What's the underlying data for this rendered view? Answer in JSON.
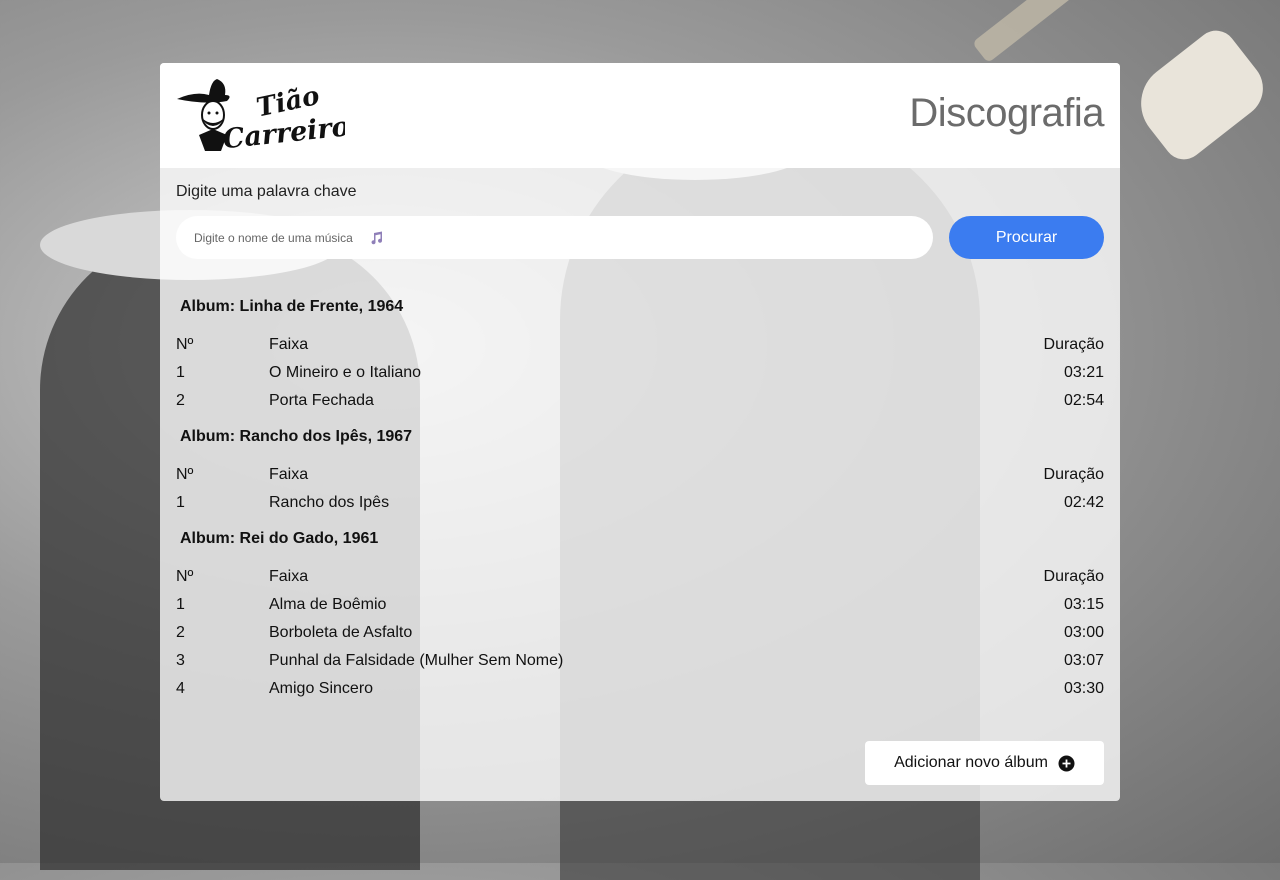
{
  "header": {
    "logo_text_line1": "Tião",
    "logo_text_line2": "Carreiro",
    "title": "Discografia"
  },
  "search": {
    "label": "Digite uma palavra chave",
    "placeholder": "Digite o nome de uma música",
    "button_label": "Procurar"
  },
  "albums": [
    {
      "title": "Album: Linha de Frente, 1964",
      "columns": [
        "Nº",
        "Faixa",
        "Duração"
      ],
      "tracks": [
        {
          "n": "1",
          "name": "O Mineiro e o Italiano",
          "duration": "03:21"
        },
        {
          "n": "2",
          "name": "Porta Fechada",
          "duration": "02:54"
        }
      ]
    },
    {
      "title": "Album: Rancho dos Ipês, 1967",
      "columns": [
        "Nº",
        "Faixa",
        "Duração"
      ],
      "tracks": [
        {
          "n": "1",
          "name": "Rancho dos Ipês",
          "duration": "02:42"
        }
      ]
    },
    {
      "title": "Album: Rei do Gado, 1961",
      "columns": [
        "Nº",
        "Faixa",
        "Duração"
      ],
      "tracks": [
        {
          "n": "1",
          "name": "Alma de Boêmio",
          "duration": "03:15"
        },
        {
          "n": "2",
          "name": "Borboleta de Asfalto",
          "duration": "03:00"
        },
        {
          "n": "3",
          "name": "Punhal da Falsidade (Mulher Sem Nome)",
          "duration": "03:07"
        },
        {
          "n": "4",
          "name": "Amigo Sincero",
          "duration": "03:30"
        }
      ]
    }
  ],
  "actions": {
    "add_album_label": "Adicionar novo álbum"
  },
  "icons": {
    "search_field": "music-note-icon",
    "add_button": "plus-circle-icon"
  },
  "colors": {
    "accent": "#3b7cf0",
    "title": "#6b6b6b"
  }
}
